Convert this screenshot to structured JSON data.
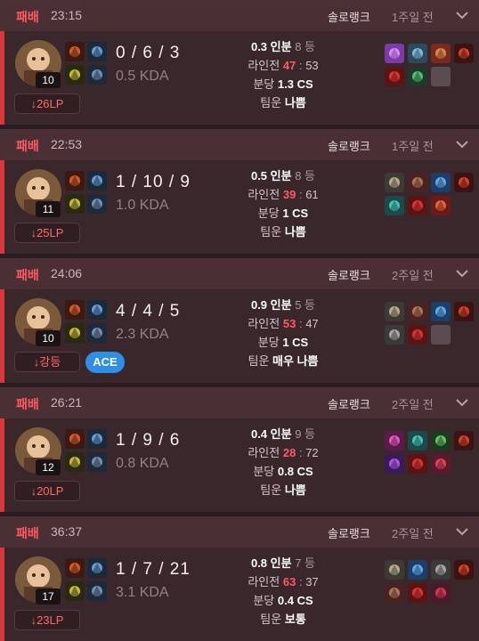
{
  "matches": [
    {
      "result": "패배",
      "duration": "23:15",
      "queue": "솔로랭크",
      "ago": "1주일 전",
      "level": "10",
      "kda": "0 / 6 / 3",
      "kda_ratio": "0.5 KDA",
      "lp": "26LP",
      "badge": "",
      "perf": "0.3 인분",
      "rank": "8 등",
      "lane_label": "라인전",
      "lane_win": "47",
      "lane_sep": ":",
      "lane_lose": "53",
      "cs_label": "분당",
      "cs": "1.3 CS",
      "luck_label": "팀운",
      "luck": "나쁨",
      "champion_icon": "champion-portrait-icon",
      "items": [
        "item-purple-orb-icon",
        "item-ward-icon",
        "item-tome-icon",
        "item-trinket-icon",
        "item-red-icon",
        "item-green-boots-icon",
        "empty"
      ]
    },
    {
      "result": "패배",
      "duration": "22:53",
      "queue": "솔로랭크",
      "ago": "1주일 전",
      "level": "11",
      "kda": "1 / 10 / 9",
      "kda_ratio": "1.0 KDA",
      "lp": "25LP",
      "badge": "",
      "perf": "0.5 인분",
      "rank": "8 등",
      "lane_label": "라인전",
      "lane_win": "39",
      "lane_sep": ":",
      "lane_lose": "61",
      "cs_label": "분당",
      "cs": "1 CS",
      "luck_label": "팀운",
      "luck": "나쁨",
      "champion_icon": "champion-portrait-icon",
      "items": [
        "item-hammer-icon",
        "item-boots-icon",
        "item-crystal-icon",
        "item-trinket-icon",
        "item-teal-icon",
        "item-red-icon",
        "item-orb-icon"
      ]
    },
    {
      "result": "패배",
      "duration": "24:06",
      "queue": "솔로랭크",
      "ago": "2주일 전",
      "level": "10",
      "kda": "4 / 4 / 5",
      "kda_ratio": "2.3 KDA",
      "lp": "강등",
      "badge": "ACE",
      "perf": "0.9 인분",
      "rank": "5 등",
      "lane_label": "라인전",
      "lane_win": "53",
      "lane_sep": ":",
      "lane_lose": "47",
      "cs_label": "분당",
      "cs": "1 CS",
      "luck_label": "팀운",
      "luck": "매우 나쁨",
      "champion_icon": "champion-portrait-icon",
      "items": [
        "item-hammer-icon",
        "item-boots-icon",
        "item-crystal-icon",
        "item-trinket-icon",
        "item-armor-icon",
        "item-red-icon",
        "empty"
      ]
    },
    {
      "result": "패배",
      "duration": "26:21",
      "queue": "솔로랭크",
      "ago": "2주일 전",
      "level": "12",
      "kda": "1 / 9 / 6",
      "kda_ratio": "0.8 KDA",
      "lp": "20LP",
      "badge": "",
      "perf": "0.4 인분",
      "rank": "9 등",
      "lane_label": "라인전",
      "lane_win": "28",
      "lane_sep": ":",
      "lane_lose": "72",
      "cs_label": "분당",
      "cs": "0.8 CS",
      "luck_label": "팀운",
      "luck": "나쁨",
      "champion_icon": "champion-portrait-icon",
      "items": [
        "item-pink-icon",
        "item-teal-icon",
        "item-green-icon",
        "item-trinket-icon",
        "item-purple-icon",
        "item-red-icon",
        "item-red-flower-icon"
      ]
    },
    {
      "result": "패배",
      "duration": "36:37",
      "queue": "솔로랭크",
      "ago": "2주일 전",
      "level": "17",
      "kda": "1 / 7 / 21",
      "kda_ratio": "3.1 KDA",
      "lp": "23LP",
      "badge": "",
      "perf": "0.8 인분",
      "rank": "7 등",
      "lane_label": "라인전",
      "lane_win": "63",
      "lane_sep": ":",
      "lane_lose": "37",
      "cs_label": "분당",
      "cs": "0.4 CS",
      "luck_label": "팀운",
      "luck": "보통",
      "champion_icon": "champion-portrait-icon",
      "items": [
        "item-hammer-icon",
        "item-crystal-icon",
        "item-armor-icon",
        "item-trinket-icon",
        "item-boots-icon",
        "item-red-icon",
        "item-ruby-icon"
      ]
    }
  ],
  "colors": {
    "loss": "#ff5a5f",
    "ace": "#2f8ee6",
    "card": "#3a272c",
    "header": "#4a2f35"
  }
}
